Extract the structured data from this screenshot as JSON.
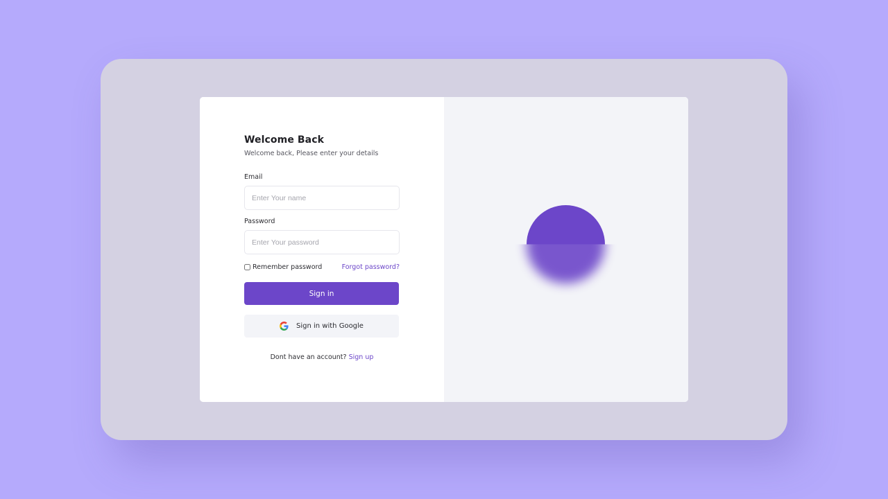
{
  "login": {
    "title": "Welcome Back",
    "subtitle": "Welcome back, Please enter your details",
    "email": {
      "label": "Email",
      "value": "",
      "placeholder": "Enter Your name"
    },
    "password": {
      "label": "Password",
      "value": "",
      "placeholder": "Enter Your password"
    },
    "remember_label": "Remember password",
    "remember_checked": false,
    "forgot_label": "Forgot password?",
    "sign_in_label": "Sign in",
    "google_label": "Sign in with Google",
    "no_account_text": "Dont have an account?",
    "sign_up_label": "Sign up"
  },
  "icons": {
    "google": "google-g-icon"
  },
  "colors": {
    "background": "#b5aafc",
    "frame": "#d4d1e2",
    "accent": "#6c46c9",
    "panel": "#f3f4f8",
    "card": "#ffffff"
  }
}
